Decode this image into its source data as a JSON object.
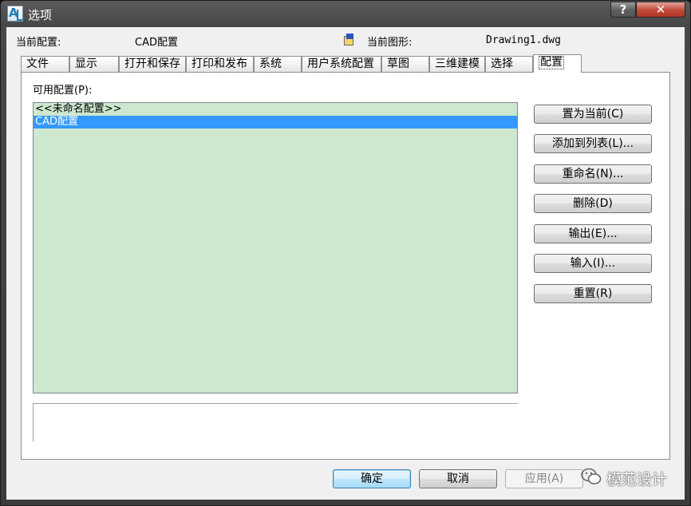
{
  "window": {
    "title": "选项",
    "help_glyph": "?",
    "close_glyph": "✕"
  },
  "header": {
    "current_profile_label": "当前配置:",
    "current_profile_value": "CAD配置",
    "current_drawing_label": "当前图形:",
    "current_drawing_value": "Drawing1.dwg"
  },
  "tabs": [
    {
      "label": "文件"
    },
    {
      "label": "显示"
    },
    {
      "label": "打开和保存"
    },
    {
      "label": "打印和发布"
    },
    {
      "label": "系统"
    },
    {
      "label": "用户系统配置"
    },
    {
      "label": "草图"
    },
    {
      "label": "三维建模"
    },
    {
      "label": "选择"
    },
    {
      "label": "配置",
      "active": true
    }
  ],
  "profiles": {
    "label": "可用配置(P):",
    "items": [
      {
        "name": "<<未命名配置>>",
        "selected": false
      },
      {
        "name": "CAD配置",
        "selected": true
      }
    ]
  },
  "side_buttons": {
    "set_current": "置为当前(C)",
    "add_to_list": "添加到列表(L)...",
    "rename": "重命名(N)...",
    "delete": "删除(D)",
    "export": "输出(E)...",
    "import": "输入(I)...",
    "reset": "重置(R)"
  },
  "footer": {
    "ok": "确定",
    "cancel": "取消",
    "apply": "应用(A)"
  },
  "watermark": {
    "text": "模范设计"
  },
  "colors": {
    "list_background": "#cde8cf",
    "selection": "#3399ff"
  }
}
